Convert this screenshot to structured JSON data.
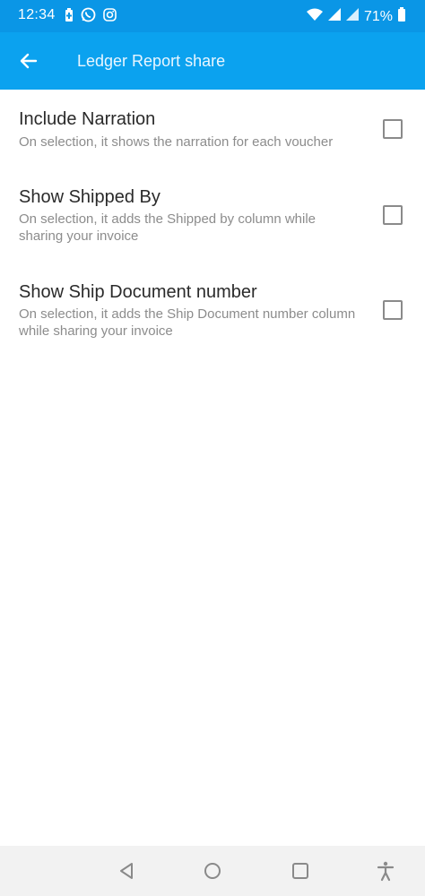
{
  "status_bar": {
    "time": "12:34",
    "battery_percent": "71%",
    "icons": [
      "battery-saver-icon",
      "whatsapp-icon",
      "instagram-icon",
      "wifi-icon",
      "signal-icon",
      "signal-icon",
      "battery-icon"
    ]
  },
  "app_bar": {
    "title": "Ledger Report share",
    "background": "#0ba2ef"
  },
  "settings": [
    {
      "title": "Include Narration",
      "description": "On selection, it shows the narration for each voucher",
      "checked": false
    },
    {
      "title": "Show Shipped By",
      "description": "On selection, it adds the Shipped by column while sharing your invoice",
      "checked": false
    },
    {
      "title": "Show Ship Document number",
      "description": "On selection, it adds the Ship Document number column while sharing your invoice",
      "checked": false
    }
  ],
  "nav_bar": {
    "buttons": [
      "back-icon",
      "home-icon",
      "recents-icon",
      "accessibility-icon"
    ]
  }
}
